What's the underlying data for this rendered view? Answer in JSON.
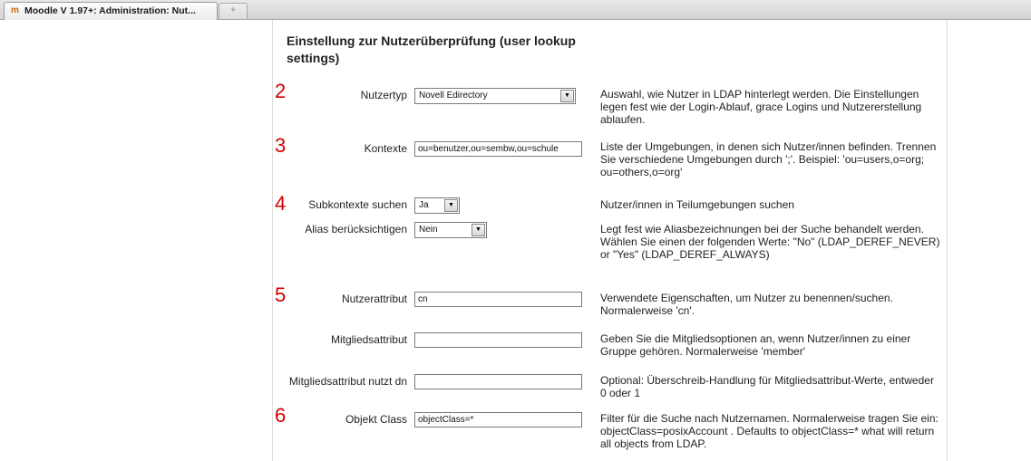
{
  "browser": {
    "tab_title": "Moodle V 1.97+: Administration: Nut...",
    "favicon_glyph": "m",
    "new_tab_glyph": "+"
  },
  "section_heading": "Einstellung zur Nutzerüberprüfung (user lookup settings)",
  "accent_color": "#d40000",
  "fields": {
    "user_type": {
      "marker": "2",
      "label": "Nutzertyp",
      "value": "Novell Edirectory",
      "description": "Auswahl, wie Nutzer in LDAP hinterlegt werden. Die Einstellungen legen fest wie der Login-Ablauf, grace Logins und Nutzererstellung ablaufen."
    },
    "contexts": {
      "marker": "3",
      "label": "Kontexte",
      "value": "ou=benutzer,ou=sembw,ou=schule",
      "description": "Liste der Umgebungen, in denen sich Nutzer/innen befinden. Trennen Sie verschiedene Umgebungen durch ';'. Beispiel: 'ou=users,o=org; ou=others,o=org'"
    },
    "search_subcontexts": {
      "marker": "4",
      "label": "Subkontexte suchen",
      "value": "Ja",
      "description": "Nutzer/innen in Teilumgebungen suchen"
    },
    "dereference_aliases": {
      "label": "Alias berücksichtigen",
      "value": "Nein",
      "description": "Legt fest wie Aliasbezeichnungen bei der Suche behandelt werden. Wählen Sie einen der folgenden Werte: \"No\" (LDAP_DEREF_NEVER) or \"Yes\" (LDAP_DEREF_ALWAYS)"
    },
    "user_attribute": {
      "marker": "5",
      "label": "Nutzerattribut",
      "value": "cn",
      "description": "Verwendete Eigenschaften, um Nutzer zu benennen/suchen. Normalerweise 'cn'."
    },
    "member_attribute": {
      "label": "Mitgliedsattribut",
      "value": "",
      "description": "Geben Sie die Mitgliedsoptionen an, wenn Nutzer/innen zu einer Gruppe gehören. Normalerweise 'member'"
    },
    "member_attribute_uses_dn": {
      "label": "Mitgliedsattribut nutzt dn",
      "value": "",
      "description": "Optional: Überschreib-Handlung für Mitgliedsattribut-Werte, entweder 0 oder 1"
    },
    "object_class": {
      "marker": "6",
      "label": "Objekt Class",
      "value": "objectClass=*",
      "description": "Filter für die Suche nach Nutzernamen. Normalerweise tragen Sie ein: objectClass=posixAccount . Defaults to objectClass=* what will return all objects from LDAP."
    }
  }
}
